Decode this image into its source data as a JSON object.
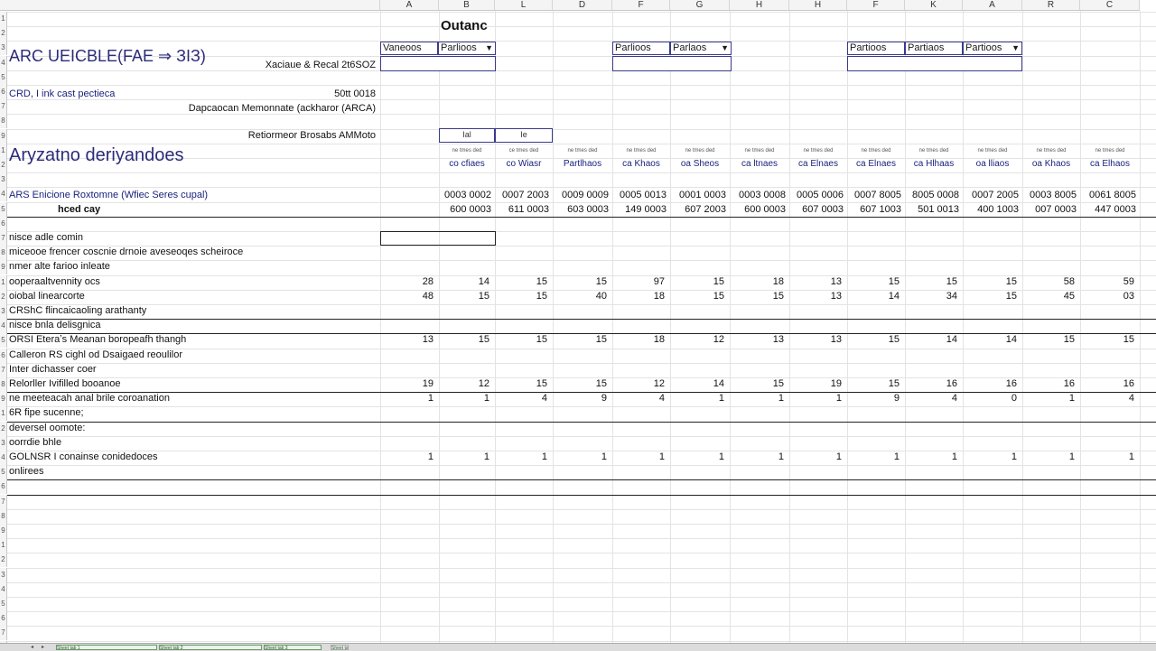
{
  "column_headers": [
    "A",
    "B",
    "L",
    "D",
    "F",
    "G",
    "H",
    "H",
    "F",
    "K",
    "A",
    "R",
    "C"
  ],
  "sheet": {
    "title": "Outanc",
    "org_title": "ARC UEICBLE(FAE ⇒ ЗIЗ)",
    "exchange_label": "Xaciaue & Recal 2t6SOZ",
    "section_label": "CRD, I ink cast pectieca",
    "section_value": "50tt 0018",
    "description_label": "Dapcaocan Memonnate (ackharor (ARCA)",
    "retirement_label": "Retiormeor Brosabs AMMoto",
    "retirement_sub": [
      "Ial",
      "Ie"
    ],
    "analysis_heading": "Aryzatno deriyandoes",
    "ars_label": "ARS Enicione Roxtomne (Wfiec Seres cupal)",
    "head_label": "hced cay"
  },
  "dropdowns": [
    {
      "label": "Vaneoos",
      "value": "Parlioos"
    },
    {
      "label": "Parlioos",
      "value": "Parlaos"
    },
    {
      "label": "Partioos",
      "value": "Partiaos"
    },
    {
      "label": "Parlicos",
      "value": "Partioos"
    }
  ],
  "column_subheaders": [
    "co cfiaes",
    "co Wiasr",
    "Partlhaos",
    "ca Khaos",
    "oa Sheos",
    "ca ltnaes",
    "ca Elnaes",
    "ca Elnaes",
    "ca Hlhaas",
    "oa lliaos",
    "oa Khaos",
    "ca Elhaos"
  ],
  "column_tiny": [
    "ne tmes ded",
    "ce tmes ded",
    "ne tmes ded",
    "ne tmes ded",
    "ne tmes ded",
    "ne tmes ded",
    "ne tmes ded",
    "ne tmes ded",
    "ne tmes ded",
    "ne tmes ded",
    "ne tmes ded",
    "ne tmes ded"
  ],
  "ars_row": [
    "0003 0002",
    "0007 2003",
    "0009 0009",
    "0005 0013",
    "0001 0003",
    "0003 0008",
    "0005 0006",
    "0007 8005",
    "8005 0008",
    "0007 2005",
    "0003 8005",
    "0061 8005"
  ],
  "head_row": [
    "600 0003",
    "611 0003",
    "603 0003",
    "149 0003",
    "607 2003",
    "600 0003",
    "607 0003",
    "607 1003",
    "501 0013",
    "400 1003",
    "007 0003",
    "447 0003"
  ],
  "rows": [
    {
      "label": "nisce adle comin",
      "values": null
    },
    {
      "label": "miceooe frencer coscnie drnoie aveseoqes scheiroce",
      "values": null
    },
    {
      "label": "nmer alte farioo inleate",
      "values": null
    },
    {
      "label": "ooperaaltvennity ocs",
      "values": [
        "28",
        "14",
        "15",
        "15",
        "97",
        "15",
        "18",
        "13",
        "15",
        "15",
        "15",
        "58",
        "59"
      ]
    },
    {
      "label": "oiobal linearcorte",
      "values": [
        "48",
        "15",
        "15",
        "40",
        "18",
        "15",
        "15",
        "13",
        "14",
        "34",
        "15",
        "45",
        "03"
      ]
    },
    {
      "label": "CRShC flincaicaoling arathanty",
      "values": null
    },
    {
      "label": "nisce bnla delisgnica",
      "values": null
    },
    {
      "label": "ORSI Eteraʼs Meanan boropeafh thangh",
      "values": [
        "13",
        "15",
        "15",
        "15",
        "18",
        "12",
        "13",
        "13",
        "15",
        "14",
        "14",
        "15",
        "15"
      ]
    },
    {
      "label": "Calleron RS cighl od Dsaigaed reoulilor",
      "values": null
    },
    {
      "label": "Inter dichasser coer",
      "values": null
    },
    {
      "label": "Relorller Ivifilled booanoe",
      "values": [
        "19",
        "12",
        "15",
        "15",
        "12",
        "14",
        "15",
        "19",
        "15",
        "16",
        "16",
        "16",
        "16"
      ]
    },
    {
      "label": "ne meeteacah anal brile coroanation",
      "values": [
        "1",
        "1",
        "4",
        "9",
        "4",
        "1",
        "1",
        "1",
        "9",
        "4",
        "0",
        "1",
        "4"
      ]
    },
    {
      "label": "6R fipe sucenne;",
      "values": null
    },
    {
      "label": "deversel oomote:",
      "values": null
    },
    {
      "label": "oorrdie bhle",
      "values": null
    },
    {
      "label": "GOLNSR I conainse conidedoces",
      "values": [
        "1",
        "1",
        "1",
        "1",
        "1",
        "1",
        "1",
        "1",
        "1",
        "1",
        "1",
        "1",
        "1"
      ]
    },
    {
      "label": "onlirees",
      "values": null
    }
  ],
  "row_numbers": [
    "1",
    "2",
    "3",
    "4",
    "5",
    "6",
    "7",
    "8",
    "9",
    "1",
    "2",
    "3",
    "4",
    "5",
    "6",
    "7",
    "8",
    "9",
    "1",
    "2",
    "3",
    "4",
    "5",
    "6",
    "7",
    "8",
    "9",
    "1",
    "2",
    "3",
    "4",
    "5",
    "6",
    "7",
    "8",
    "9",
    "1",
    "2",
    "3",
    "4",
    "5",
    "6",
    "7",
    "8"
  ],
  "tabs": [
    "Sheet tab 1",
    "Sheet tab 2",
    "Sheet tab 3",
    "Sheet tab 4"
  ],
  "tab_nav": [
    "◂",
    "▸"
  ]
}
